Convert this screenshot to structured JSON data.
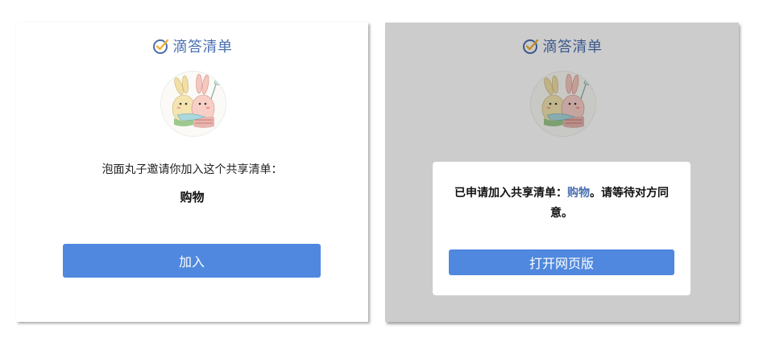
{
  "brand": {
    "name": "滴答清单",
    "icon": "check-circle-icon",
    "color": "#4a6fb0"
  },
  "invite": {
    "avatar_icon": "bunny-pair-avatar",
    "message": "泡面丸子邀请你加入这个共享清单：",
    "list_name": "购物",
    "join_label": "加入"
  },
  "modal": {
    "prefix": "已申请加入共享清单：",
    "list_name": "购物",
    "suffix": "。请等待对方同意。",
    "open_web_label": "打开网页版"
  },
  "colors": {
    "accent": "#4f88de",
    "overlay": "rgba(0,0,0,0.2)"
  }
}
